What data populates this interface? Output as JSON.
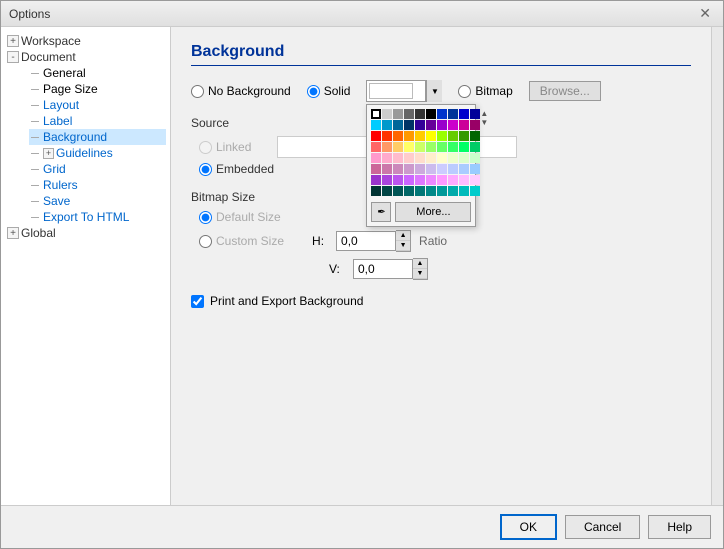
{
  "window": {
    "title": "Options",
    "close_label": "✕"
  },
  "sidebar": {
    "items": [
      {
        "id": "workspace",
        "label": "Workspace",
        "level": 0,
        "toggle": "+",
        "selected": false
      },
      {
        "id": "document",
        "label": "Document",
        "level": 0,
        "toggle": "-",
        "selected": false
      },
      {
        "id": "general",
        "label": "General",
        "level": 1,
        "selected": false
      },
      {
        "id": "page-size",
        "label": "Page Size",
        "level": 1,
        "selected": false
      },
      {
        "id": "layout",
        "label": "Layout",
        "level": 1,
        "selected": false
      },
      {
        "id": "label",
        "label": "Label",
        "level": 1,
        "selected": false
      },
      {
        "id": "background",
        "label": "Background",
        "level": 1,
        "selected": true
      },
      {
        "id": "guidelines",
        "label": "Guidelines",
        "level": 1,
        "toggle": "+",
        "selected": false
      },
      {
        "id": "grid",
        "label": "Grid",
        "level": 1,
        "selected": false
      },
      {
        "id": "rulers",
        "label": "Rulers",
        "level": 1,
        "selected": false
      },
      {
        "id": "save",
        "label": "Save",
        "level": 1,
        "selected": false
      },
      {
        "id": "export-html",
        "label": "Export To HTML",
        "level": 1,
        "selected": false
      },
      {
        "id": "global",
        "label": "Global",
        "level": 0,
        "toggle": "+",
        "selected": false
      }
    ]
  },
  "main": {
    "title": "Background",
    "bg_type": {
      "no_background_label": "No Background",
      "solid_label": "Solid",
      "bitmap_label": "Bitmap",
      "selected": "solid"
    },
    "browse_label": "Browse...",
    "source": {
      "label": "Source",
      "linked_label": "Linked",
      "embedded_label": "Embedded",
      "selected": "embedded",
      "linked_field_value": "",
      "embedded_field_value": ""
    },
    "bitmap_size": {
      "label": "Bitmap Size",
      "default_size_label": "Default Size",
      "custom_size_label": "Custom Size",
      "selected": "default",
      "h_label": "H:",
      "v_label": "V:",
      "h_value": "0,0",
      "v_value": "0,0",
      "ratio_label": "Ratio"
    },
    "print_export": {
      "label": "Print and Export Background",
      "checked": true
    }
  },
  "color_picker": {
    "visible": true,
    "eyedropper_icon": "✒",
    "more_label": "More...",
    "selected_color": "#ffffff",
    "colors": [
      "#ffffff",
      "#cccccc",
      "#999999",
      "#666666",
      "#333333",
      "#000000",
      "#0033cc",
      "#003399",
      "#0000cc",
      "#000099",
      "#00ccff",
      "#0099cc",
      "#006699",
      "#003366",
      "#330099",
      "#660099",
      "#9900cc",
      "#cc00cc",
      "#cc0099",
      "#990066",
      "#ff0000",
      "#ff3300",
      "#ff6600",
      "#ff9900",
      "#ffcc00",
      "#ffff00",
      "#99ff00",
      "#66cc00",
      "#339900",
      "#006600",
      "#ff6666",
      "#ff9966",
      "#ffcc66",
      "#ffff66",
      "#ccff66",
      "#99ff66",
      "#66ff66",
      "#33ff66",
      "#00ff66",
      "#00cc66",
      "#ff99cc",
      "#ffaacc",
      "#ffbbcc",
      "#ffcccc",
      "#ffddcc",
      "#ffeecc",
      "#ffffcc",
      "#eeffcc",
      "#ddffcc",
      "#ccffcc",
      "#cc6699",
      "#cc77aa",
      "#cc88bb",
      "#cc99cc",
      "#ccaadd",
      "#ccbbee",
      "#ccccff",
      "#bbccff",
      "#aaccff",
      "#99ccff",
      "#9933cc",
      "#aa44dd",
      "#bb55ee",
      "#cc66ff",
      "#dd77ff",
      "#ee88ff",
      "#ff99ff",
      "#ffaaff",
      "#ffbbff",
      "#ffccff",
      "#003333",
      "#004444",
      "#005555",
      "#006666",
      "#007777",
      "#008888",
      "#009999",
      "#00aaaa",
      "#00bbbb",
      "#00cccc"
    ]
  },
  "footer": {
    "ok_label": "OK",
    "cancel_label": "Cancel",
    "help_label": "Help"
  }
}
